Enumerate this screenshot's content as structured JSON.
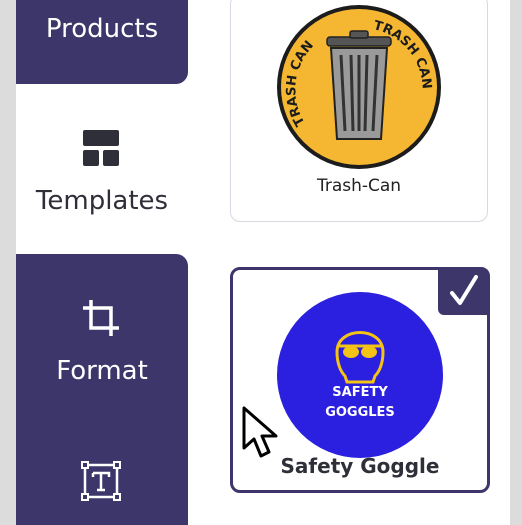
{
  "sidebar": {
    "items": [
      {
        "label": "Products",
        "icon": "products-icon",
        "active": true
      },
      {
        "label": "Templates",
        "icon": "templates-grid-icon",
        "active": false
      },
      {
        "label": "Format",
        "icon": "crop-icon",
        "active": true
      },
      {
        "label": "",
        "icon": "text-box-icon",
        "active": true
      }
    ]
  },
  "templates": {
    "cards": [
      {
        "title": "Trash-Can",
        "sign_text": "TRASH CAN",
        "selected": false,
        "image_icon": "trash-can-sign-image"
      },
      {
        "title": "Safety Goggle",
        "sign_text_line1": "SAFETY",
        "sign_text_line2": "GOGGLES",
        "selected": true,
        "image_icon": "safety-goggles-sign-image"
      }
    ]
  },
  "colors": {
    "accent": "#3c366b",
    "trash_sign_bg": "#f5b731",
    "safety_sign_bg": "#2b1fe0",
    "goggle_yellow": "#f3c316"
  }
}
